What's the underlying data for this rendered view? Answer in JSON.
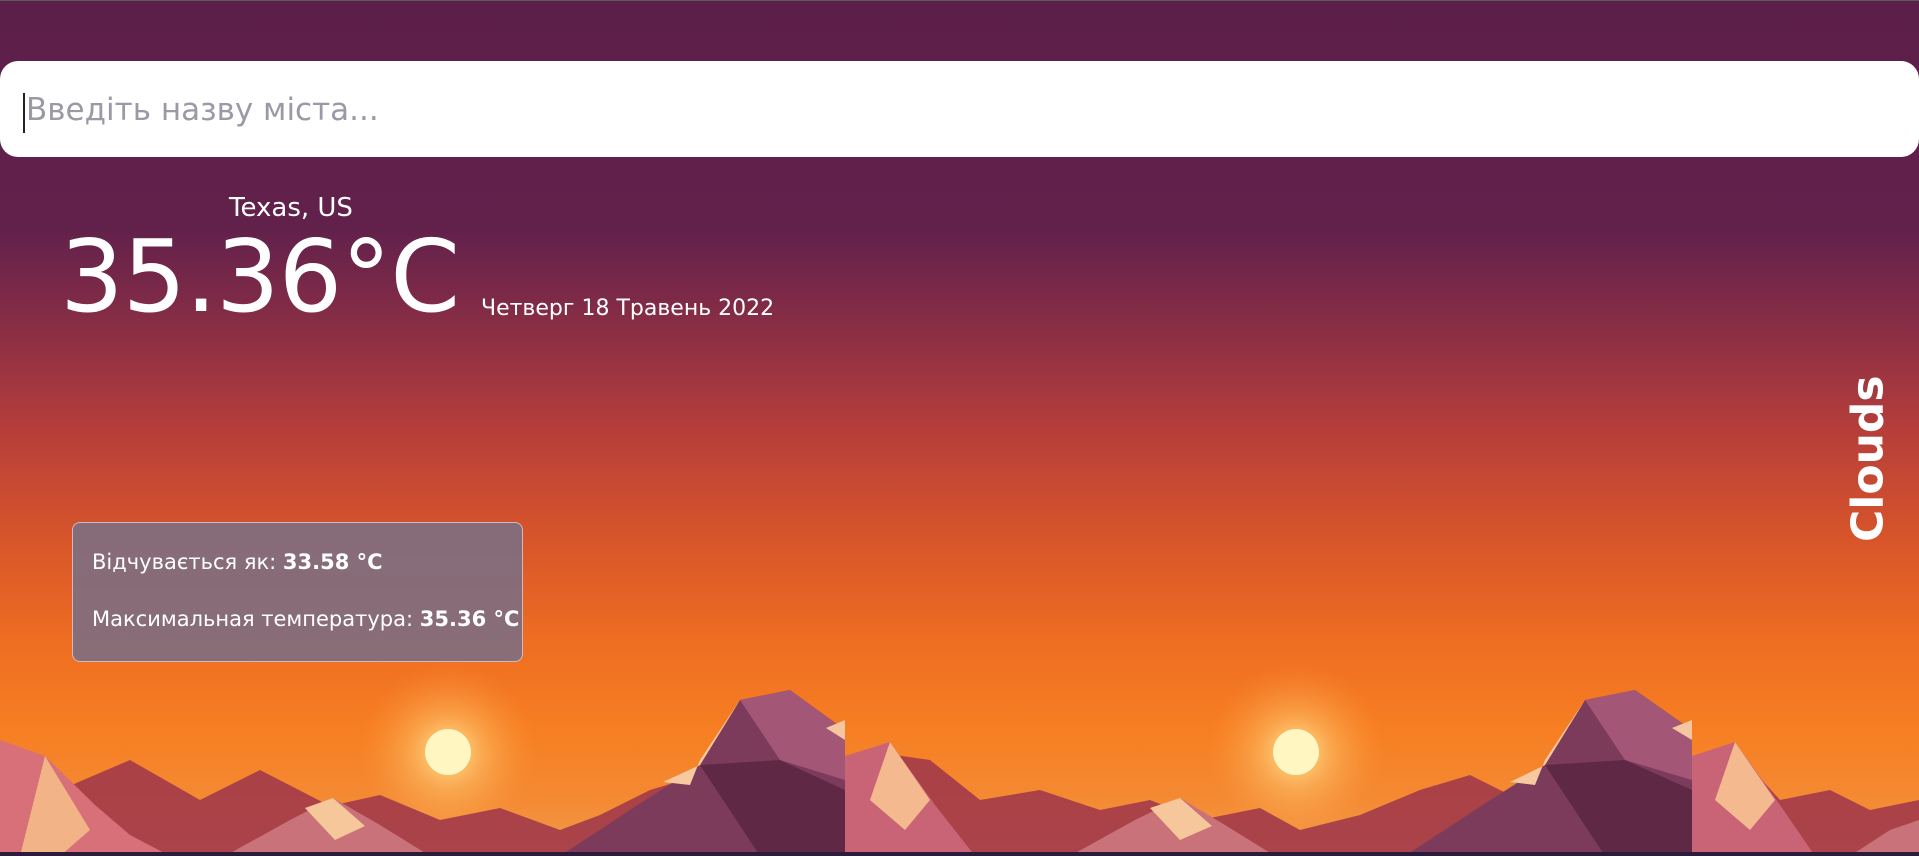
{
  "search": {
    "placeholder": "Введіть назву міста...",
    "value": ""
  },
  "weather": {
    "location": "Texas, US",
    "temperature": "35.36°C",
    "date": "Четверг 18 Травень 2022",
    "condition": "Clouds"
  },
  "details": {
    "feels_like_label": "Відчувається як:",
    "feels_like_value": "33.58 °C",
    "max_temp_label": "Максимальная температура:",
    "max_temp_value": "35.36 °C"
  },
  "colors": {
    "sky_top": "#5c1f4a",
    "sky_mid": "#b63e3a",
    "sky_low": "#f77e22",
    "details_panel": "#7d6e82",
    "text": "#ffffff"
  },
  "icons": {
    "sun": "sun-icon",
    "mountains": "mountains-illustration"
  }
}
